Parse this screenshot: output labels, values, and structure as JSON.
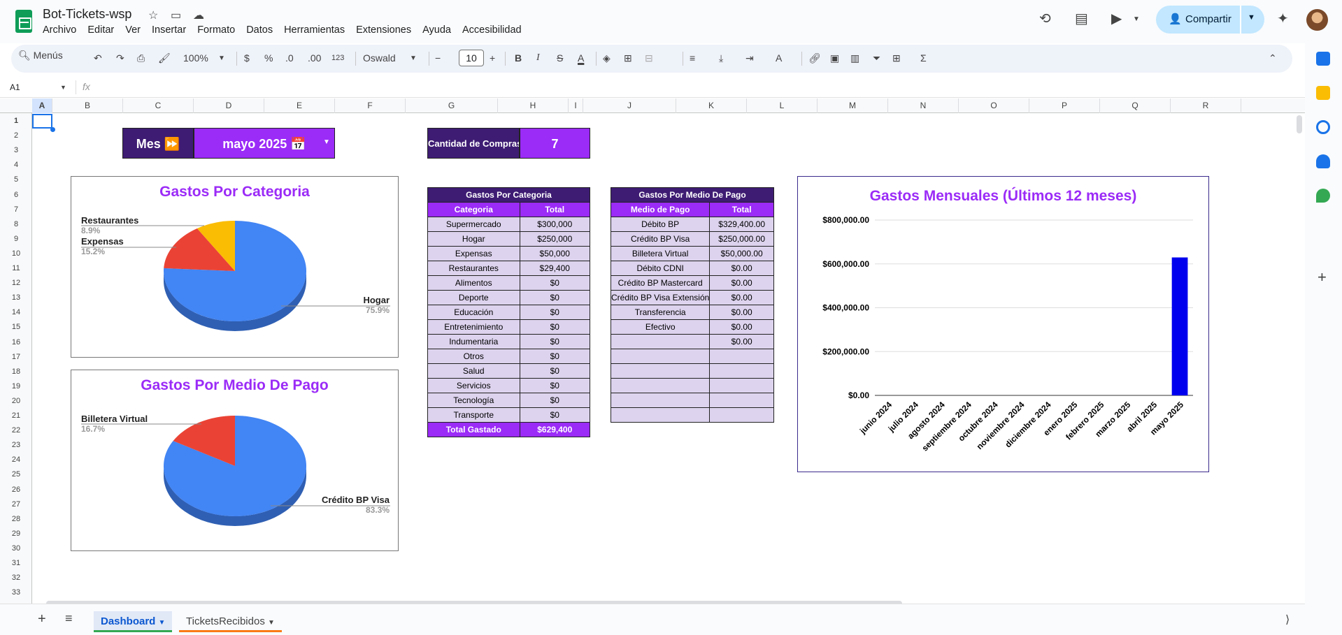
{
  "app": {
    "title": "Bot-Tickets-wsp"
  },
  "menu": [
    "Archivo",
    "Editar",
    "Ver",
    "Insertar",
    "Formato",
    "Datos",
    "Herramientas",
    "Extensiones",
    "Ayuda",
    "Accesibilidad"
  ],
  "share": {
    "label": "Compartir"
  },
  "toolbar": {
    "search_label": "Menús",
    "zoom": "100%",
    "currency": "$",
    "percent": "%",
    "dec_minus": ".0",
    "dec_plus": ".00",
    "format_123": "123",
    "font": "Oswald",
    "font_size": "10"
  },
  "namebox": "A1",
  "columns": [
    "A",
    "B",
    "C",
    "D",
    "E",
    "F",
    "G",
    "H",
    "I",
    "J",
    "K",
    "L",
    "M",
    "N",
    "O",
    "P",
    "Q",
    "R"
  ],
  "rows": [
    "1",
    "2",
    "3",
    "4",
    "5",
    "6",
    "7",
    "8",
    "9",
    "10",
    "11",
    "12",
    "13",
    "14",
    "15",
    "16",
    "17",
    "18",
    "19",
    "20",
    "21",
    "22",
    "23",
    "24",
    "25",
    "26",
    "27",
    "28",
    "29",
    "30",
    "31",
    "32",
    "33"
  ],
  "dashboard": {
    "mes_label": "Mes ⏩",
    "mes_value": "mayo 2025 📅",
    "cantidad_label": "Cantidad de Compras",
    "cantidad_value": "7"
  },
  "cat_table": {
    "title": "Gastos Por Categoria",
    "headers": [
      "Categoria",
      "Total"
    ],
    "rows": [
      [
        "Supermercado",
        "$300,000"
      ],
      [
        "Hogar",
        "$250,000"
      ],
      [
        "Expensas",
        "$50,000"
      ],
      [
        "Restaurantes",
        "$29,400"
      ],
      [
        "Alimentos",
        "$0"
      ],
      [
        "Deporte",
        "$0"
      ],
      [
        "Educación",
        "$0"
      ],
      [
        "Entretenimiento",
        "$0"
      ],
      [
        "Indumentaria",
        "$0"
      ],
      [
        "Otros",
        "$0"
      ],
      [
        "Salud",
        "$0"
      ],
      [
        "Servicios",
        "$0"
      ],
      [
        "Tecnología",
        "$0"
      ],
      [
        "Transporte",
        "$0"
      ]
    ],
    "total_label": "Total Gastado",
    "total_value": "$629,400"
  },
  "pay_table": {
    "title": "Gastos Por Medio De Pago",
    "headers": [
      "Medio de Pago",
      "Total"
    ],
    "rows": [
      [
        "Débito BP",
        "$329,400.00"
      ],
      [
        "Crédito BP Visa",
        "$250,000.00"
      ],
      [
        "Billetera Virtual",
        "$50,000.00"
      ],
      [
        "Débito CDNI",
        "$0.00"
      ],
      [
        "Crédito BP Mastercard",
        "$0.00"
      ],
      [
        "Crédito BP Visa Extensión",
        "$0.00"
      ],
      [
        "Transferencia",
        "$0.00"
      ],
      [
        "Efectivo",
        "$0.00"
      ],
      [
        "",
        "$0.00"
      ],
      [
        "",
        ""
      ],
      [
        "",
        ""
      ],
      [
        "",
        ""
      ],
      [
        "",
        ""
      ],
      [
        "",
        ""
      ]
    ]
  },
  "pie_cat": {
    "title": "Gastos Por Categoria",
    "slices": [
      {
        "label": "Hogar",
        "pct": "75.9%",
        "value": 75.9,
        "color": "#4285f4"
      },
      {
        "label": "Expensas",
        "pct": "15.2%",
        "value": 15.2,
        "color": "#ea4335"
      },
      {
        "label": "Restaurantes",
        "pct": "8.9%",
        "value": 8.9,
        "color": "#fbbc04"
      }
    ]
  },
  "pie_pay": {
    "title": "Gastos Por Medio De Pago",
    "slices": [
      {
        "label": "Crédito BP Visa",
        "pct": "83.3%",
        "value": 83.3,
        "color": "#4285f4"
      },
      {
        "label": "Billetera Virtual",
        "pct": "16.7%",
        "value": 16.7,
        "color": "#ea4335"
      }
    ]
  },
  "chart_data": {
    "type": "bar",
    "title": "Gastos Mensuales (Últimos 12 meses)",
    "categories": [
      "junio 2024",
      "julio 2024",
      "agosto 2024",
      "septiembre 2024",
      "octubre 2024",
      "noviembre 2024",
      "diciembre 2024",
      "enero 2025",
      "febrero 2025",
      "marzo 2025",
      "abril 2025",
      "mayo 2025"
    ],
    "values": [
      0,
      0,
      0,
      0,
      0,
      0,
      0,
      0,
      0,
      0,
      0,
      629400
    ],
    "ylim": [
      0,
      800000
    ],
    "yticks": [
      "$0.00",
      "$200,000.00",
      "$400,000.00",
      "$600,000.00",
      "$800,000.00"
    ],
    "color": "#0000ee",
    "grid": true
  },
  "sheets": [
    {
      "name": "Dashboard",
      "active": true,
      "color": "#34a853"
    },
    {
      "name": "TicketsRecibidos",
      "active": false,
      "color": "#fa7b17"
    }
  ]
}
